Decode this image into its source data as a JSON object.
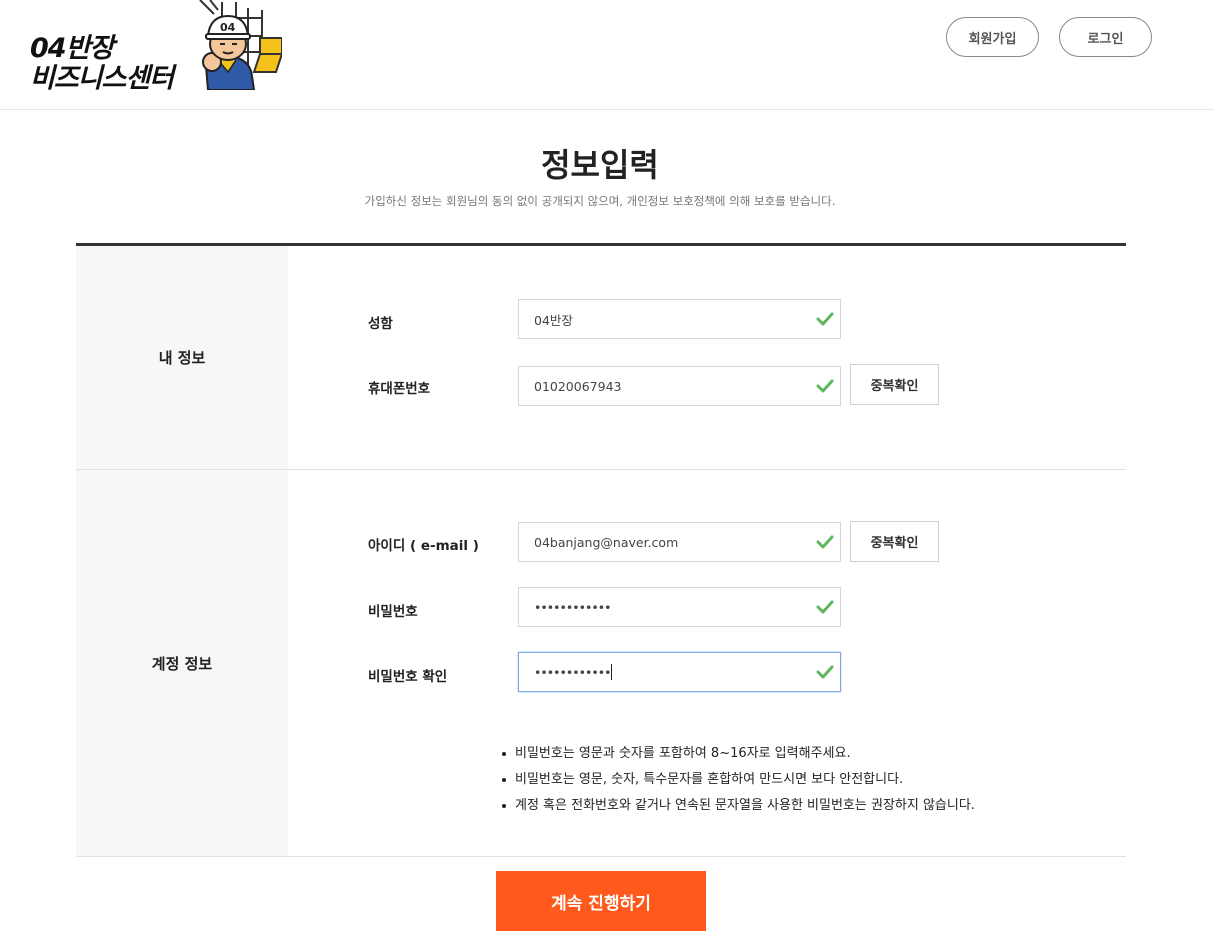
{
  "header": {
    "logo_line1": "04반장",
    "logo_line2": "비즈니스센터",
    "mascot_badge": "04",
    "join_label": "회원가입",
    "login_label": "로그인"
  },
  "page": {
    "title": "정보입력",
    "subtitle": "가입하신 정보는 회원님의 동의 없이 공개되지 않으며, 개인정보 보호정책에 의해 보호를 받습니다."
  },
  "sections": {
    "my_info": {
      "heading": "내 정보",
      "name_label": "성함",
      "name_value": "04반장",
      "phone_label": "휴대폰번호",
      "phone_value": "01020067943",
      "phone_dup_label": "중복확인"
    },
    "account": {
      "heading": "계정 정보",
      "id_label": "아이디 ( e-mail )",
      "id_value": "04banjang@naver.com",
      "id_dup_label": "중복확인",
      "pw_label": "비밀번호",
      "pw_value": "••••••••••••",
      "pw_confirm_label": "비밀번호 확인",
      "pw_confirm_value": "••••••••••••",
      "notes": [
        "비밀번호는 영문과 숫자를 포함하여 8~16자로 입력해주세요.",
        "비밀번호는 영문, 숫자, 특수문자를 혼합하여 만드시면 보다 안전합니다.",
        "계정 혹은 전화번호와 같거나 연속된 문자열을 사용한 비밀번호는 권장하지 않습니다."
      ]
    }
  },
  "submit_label": "계속 진행하기",
  "colors": {
    "accent": "#ff5a1b",
    "check": "#5cb85c",
    "section_bg": "#f7f7f5",
    "focus_border": "#7fa6e6"
  },
  "icons": {
    "valid": "check-icon"
  }
}
